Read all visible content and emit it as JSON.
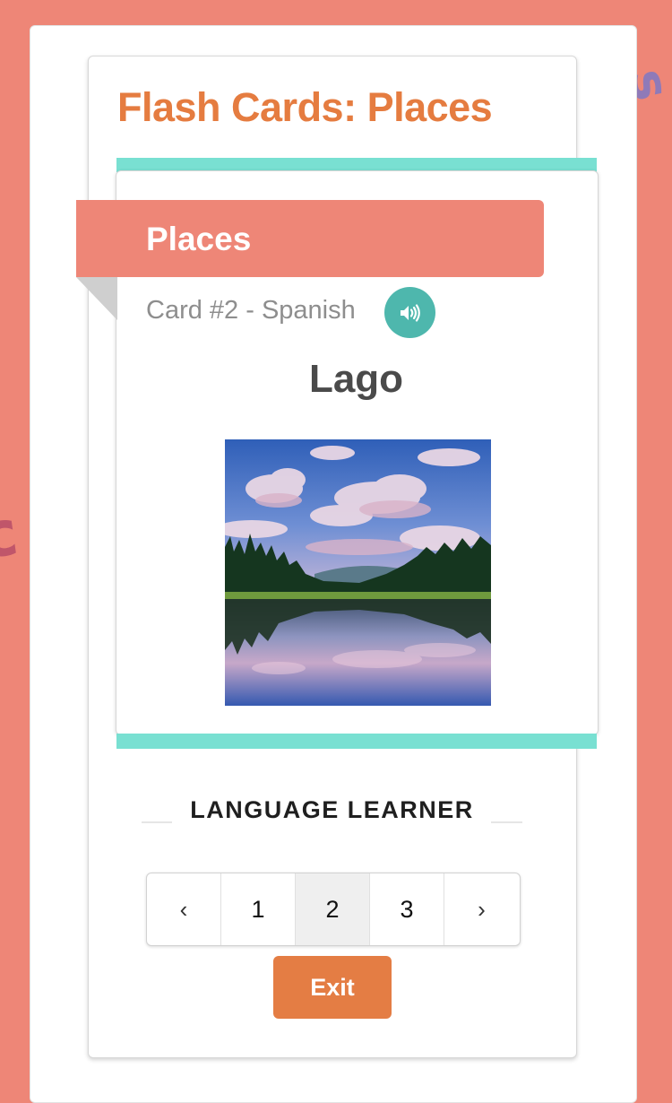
{
  "page": {
    "title": "Flash Cards: Places"
  },
  "card": {
    "category": "Places",
    "subtitle": "Card #2 - Spanish",
    "word": "Lago",
    "image": "lake-reflection-landscape"
  },
  "section": {
    "label": "LANGUAGE LEARNER"
  },
  "pagination": {
    "prev": "‹",
    "next": "›",
    "pages": [
      "1",
      "2",
      "3"
    ],
    "current": "2"
  },
  "actions": {
    "exit_label": "Exit"
  },
  "colors": {
    "background": "#ee8677",
    "title": "#e57c40",
    "teal": "#79e0d2",
    "audio": "#4eb7ad",
    "exit": "#e47d44"
  }
}
